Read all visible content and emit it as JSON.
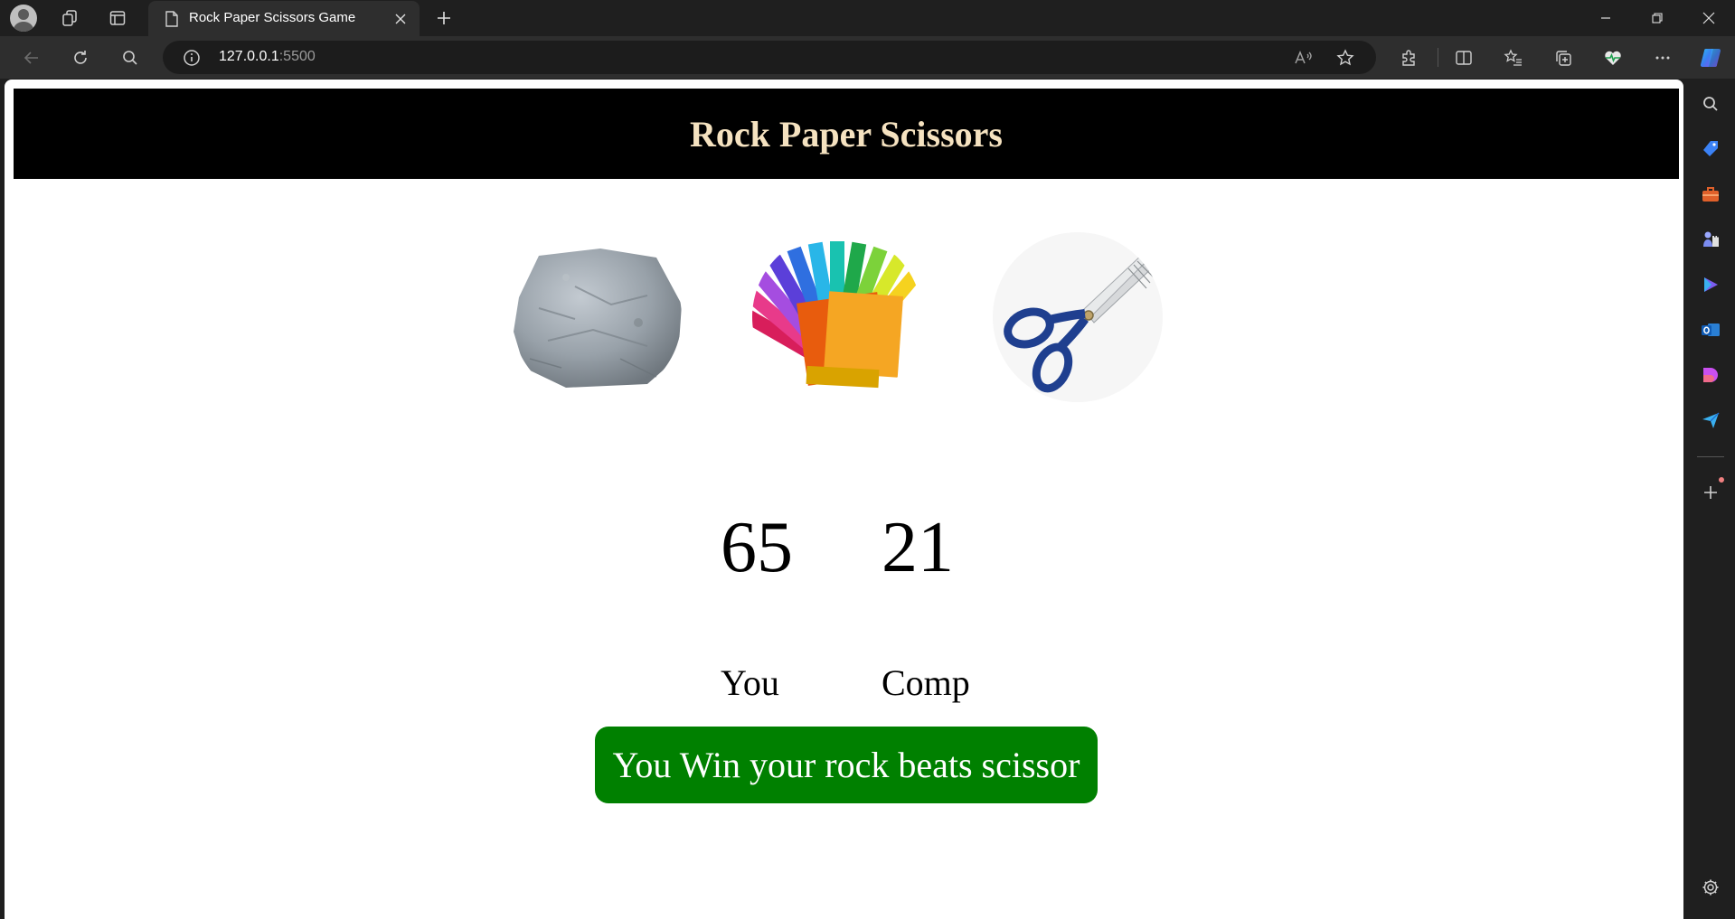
{
  "browser": {
    "tab": {
      "title": "Rock Paper Scissors Game",
      "icon": "document-icon"
    },
    "address": {
      "host": "127.0.0.1",
      "port": ":5500"
    },
    "accent": "#2e2e2e"
  },
  "page": {
    "header_title": "Rock Paper Scissors",
    "choices": [
      {
        "name": "rock",
        "icon": "rock-image"
      },
      {
        "name": "paper",
        "icon": "paper-image"
      },
      {
        "name": "scissors",
        "icon": "scissors-image"
      }
    ],
    "scores": {
      "user": "65",
      "comp": "21"
    },
    "labels": {
      "user": "You",
      "comp": "Comp"
    },
    "message": "You Win your rock beats scissor",
    "colors": {
      "header_bg": "#000000",
      "title": "#f5e2c0",
      "message_bg": "#008000"
    }
  }
}
